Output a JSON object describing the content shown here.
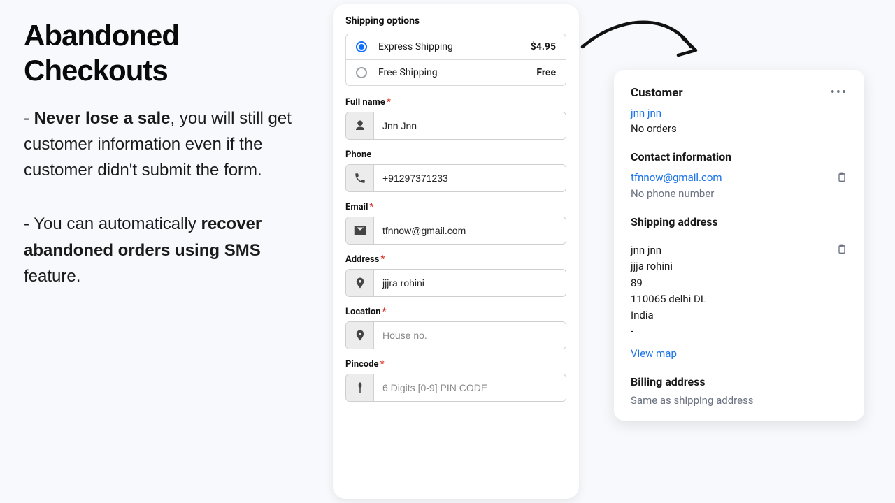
{
  "left": {
    "title": "Abandoned Checkouts",
    "para1_prefix": "- ",
    "para1_bold": "Never lose a sale",
    "para1_rest": ", you will still get customer information even if the customer didn't submit the form.",
    "para2_prefix": "- You can automatically ",
    "para2_bold": "recover abandoned orders using SMS",
    "para2_rest": " feature."
  },
  "form": {
    "shipping_title": "Shipping options",
    "options": [
      {
        "label": "Express Shipping",
        "price": "$4.95",
        "selected": true
      },
      {
        "label": "Free Shipping",
        "price": "Free",
        "selected": false
      }
    ],
    "full_name_label": "Full name",
    "full_name_value": "Jnn Jnn",
    "phone_label": "Phone",
    "phone_value": "+91297371233",
    "email_label": "Email",
    "email_value": "tfnnow@gmail.com",
    "address_label": "Address",
    "address_value": "jjjra rohini",
    "location_label": "Location",
    "location_placeholder": "House no.",
    "pincode_label": "Pincode",
    "pincode_placeholder": "6 Digits [0-9] PIN CODE"
  },
  "customer": {
    "heading": "Customer",
    "name_link": "jnn jnn",
    "orders_text": "No orders",
    "contact_heading": "Contact information",
    "email": "tfnnow@gmail.com",
    "phone_text": "No phone number",
    "shipping_heading": "Shipping address",
    "addr_line1": "jnn jnn",
    "addr_line2": "jjja rohini",
    "addr_line3": "89",
    "addr_line4": "110065 delhi DL",
    "addr_line5": "India",
    "addr_line6": "-",
    "view_map": "View map",
    "billing_heading": "Billing address",
    "billing_text": "Same as shipping address"
  }
}
